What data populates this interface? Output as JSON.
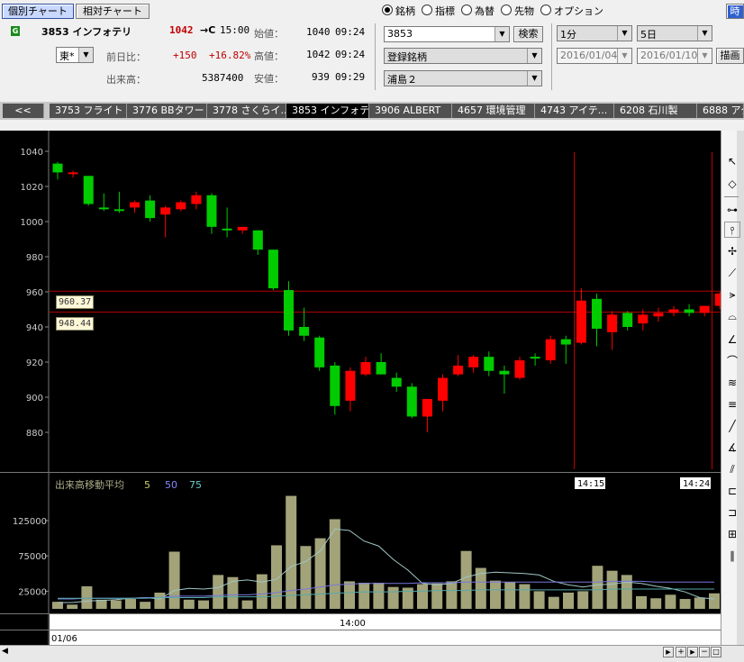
{
  "header": {
    "tab_individual": "個別チャート",
    "tab_relative": "相対チャート",
    "badge": "G",
    "code_name": "3853 インフォテリ",
    "price": "1042",
    "price_arrow": "→C",
    "price_time": "15:00",
    "open_label": "始値：",
    "open_value": "1040",
    "open_time": "09:24",
    "market": "東*",
    "change_label": "前日比：",
    "change_value": "+150",
    "change_pct": "+16.82%",
    "high_label": "高値：",
    "high_value": "1042",
    "high_time": "09:24",
    "volume_label": "出来高：",
    "volume_value": "5387400",
    "low_label": "安値：",
    "low_value": "939",
    "low_time": "09:29"
  },
  "controls": {
    "radios": [
      "銘柄",
      "指標",
      "為替",
      "先物",
      "オプション"
    ],
    "symbol_value": "3853",
    "search_button": "検索",
    "list1": "登録銘柄",
    "list2": "浦島２",
    "interval": "1分",
    "span": "5日",
    "date_from": "2016/01/04",
    "date_to": "2016/01/10",
    "draw_button": "描画",
    "corner": "時"
  },
  "tabs": [
    "<<",
    "3753 フライト",
    "3776 BBタワー",
    "3778 さくらイ...",
    "3853 インフォテリ",
    "3906 ALBERT",
    "4657 環境管理",
    "4743 アイテ...",
    "6208 石川製",
    "6888 アク"
  ],
  "price_axis": [
    "1040",
    "1020",
    "1000",
    "980",
    "960",
    "940",
    "920",
    "900",
    "880"
  ],
  "line_labels": {
    "upper": "960.37",
    "lower": "948.44"
  },
  "time_markers": {
    "left": "14:15",
    "right": "14:24"
  },
  "volume": {
    "title": "出来高移動平均",
    "ma": [
      "5",
      "50",
      "75"
    ],
    "axis": [
      "125000",
      "75000",
      "25000"
    ]
  },
  "x_axis": {
    "time": "14:00",
    "date": "01/06"
  },
  "colors": {
    "up": "#ff0000",
    "down": "#00cc00",
    "bg": "#000000",
    "volume_bar": "#a3a37a"
  },
  "chart_data": {
    "type": "candlestick",
    "ylim": [
      860,
      1045
    ],
    "candles": [
      {
        "o": 1033,
        "h": 1034,
        "l": 1024,
        "c": 1028
      },
      {
        "o": 1027,
        "h": 1029,
        "l": 1025,
        "c": 1028
      },
      {
        "o": 1026,
        "h": 1026,
        "l": 1009,
        "c": 1010
      },
      {
        "o": 1008,
        "h": 1016,
        "l": 1006,
        "c": 1007
      },
      {
        "o": 1007,
        "h": 1017,
        "l": 1005,
        "c": 1006
      },
      {
        "o": 1008,
        "h": 1012,
        "l": 1005,
        "c": 1011
      },
      {
        "o": 1012,
        "h": 1015,
        "l": 1000,
        "c": 1002
      },
      {
        "o": 1004,
        "h": 1009,
        "l": 991,
        "c": 1008
      },
      {
        "o": 1007,
        "h": 1012,
        "l": 1006,
        "c": 1011
      },
      {
        "o": 1010,
        "h": 1017,
        "l": 1007,
        "c": 1015
      },
      {
        "o": 1015,
        "h": 1016,
        "l": 993,
        "c": 997
      },
      {
        "o": 996,
        "h": 1008,
        "l": 991,
        "c": 995
      },
      {
        "o": 995,
        "h": 997,
        "l": 993,
        "c": 997
      },
      {
        "o": 995,
        "h": 995,
        "l": 981,
        "c": 984
      },
      {
        "o": 984,
        "h": 984,
        "l": 961,
        "c": 962
      },
      {
        "o": 961,
        "h": 966,
        "l": 935,
        "c": 938
      },
      {
        "o": 940,
        "h": 951,
        "l": 932,
        "c": 935
      },
      {
        "o": 934,
        "h": 935,
        "l": 915,
        "c": 917
      },
      {
        "o": 918,
        "h": 920,
        "l": 890,
        "c": 895
      },
      {
        "o": 898,
        "h": 917,
        "l": 892,
        "c": 915
      },
      {
        "o": 913,
        "h": 923,
        "l": 912,
        "c": 920
      },
      {
        "o": 920,
        "h": 925,
        "l": 913,
        "c": 913
      },
      {
        "o": 911,
        "h": 914,
        "l": 903,
        "c": 906
      },
      {
        "o": 906,
        "h": 908,
        "l": 888,
        "c": 889
      },
      {
        "o": 889,
        "h": 899,
        "l": 880,
        "c": 899
      },
      {
        "o": 898,
        "h": 913,
        "l": 892,
        "c": 911
      },
      {
        "o": 913,
        "h": 924,
        "l": 912,
        "c": 918
      },
      {
        "o": 917,
        "h": 924,
        "l": 914,
        "c": 923
      },
      {
        "o": 923,
        "h": 926,
        "l": 912,
        "c": 915
      },
      {
        "o": 915,
        "h": 918,
        "l": 902,
        "c": 913
      },
      {
        "o": 911,
        "h": 923,
        "l": 910,
        "c": 921
      },
      {
        "o": 923,
        "h": 925,
        "l": 918,
        "c": 922
      },
      {
        "o": 921,
        "h": 935,
        "l": 919,
        "c": 933
      },
      {
        "o": 933,
        "h": 935,
        "l": 919,
        "c": 930
      },
      {
        "o": 931,
        "h": 962,
        "l": 930,
        "c": 955
      },
      {
        "o": 956,
        "h": 959,
        "l": 929,
        "c": 939
      },
      {
        "o": 937,
        "h": 949,
        "l": 927,
        "c": 947
      },
      {
        "o": 948,
        "h": 949,
        "l": 938,
        "c": 940
      },
      {
        "o": 942,
        "h": 950,
        "l": 938,
        "c": 947
      },
      {
        "o": 946,
        "h": 951,
        "l": 943,
        "c": 948
      },
      {
        "o": 948,
        "h": 952,
        "l": 946,
        "c": 950
      },
      {
        "o": 950,
        "h": 953,
        "l": 946,
        "c": 948
      },
      {
        "o": 948,
        "h": 952,
        "l": 946,
        "c": 952
      },
      {
        "o": 952,
        "h": 960,
        "l": 950,
        "c": 959
      }
    ],
    "volumes": [
      10000,
      6000,
      32000,
      13000,
      12000,
      14000,
      10000,
      23000,
      81000,
      13000,
      12000,
      48000,
      45000,
      12000,
      49000,
      90000,
      160000,
      89000,
      100000,
      127000,
      39000,
      37000,
      37000,
      31000,
      30000,
      35000,
      36000,
      39000,
      82000,
      58000,
      40000,
      38000,
      35000,
      25000,
      17000,
      23000,
      25000,
      61000,
      54000,
      48000,
      18000,
      15000,
      20000,
      14000,
      16000,
      22000
    ],
    "ma_series": {
      "ma5": [
        9000,
        9000,
        11000,
        12000,
        13000,
        15000,
        16000,
        14000,
        26000,
        29000,
        28000,
        30000,
        39000,
        41000,
        38000,
        42000,
        60000,
        67000,
        82000,
        113000,
        111000,
        96000,
        89000,
        70000,
        55000,
        36000,
        34000,
        36000,
        45000,
        50000,
        52000,
        51000,
        50000,
        48000,
        39000,
        34000,
        31000,
        34000,
        35000,
        38000,
        36000,
        32000,
        29000,
        24000,
        16000,
        14000
      ],
      "ma50": [
        14000,
        14000,
        15000,
        15000,
        15000,
        15000,
        16000,
        16000,
        18000,
        18000,
        18000,
        19000,
        20000,
        20000,
        21000,
        23000,
        26000,
        28000,
        31000,
        34000,
        35000,
        36000,
        36000,
        36000,
        36000,
        37000,
        37000,
        37000,
        38000,
        38000,
        38000,
        38000,
        38000,
        38000,
        38000,
        38000,
        38000,
        38000,
        39000,
        39000,
        39000,
        38000,
        38000,
        38000,
        38000,
        38000
      ],
      "ma75": [
        15000,
        15000,
        15000,
        15000,
        15000,
        15000,
        15000,
        16000,
        16000,
        16000,
        16000,
        17000,
        17000,
        17000,
        17000,
        18000,
        19000,
        20000,
        21000,
        22000,
        23000,
        24000,
        24000,
        24000,
        25000,
        25000,
        26000,
        26000,
        26000,
        27000,
        27000,
        27000,
        27000,
        27000,
        27000,
        27000,
        27000,
        27000,
        28000,
        28000,
        28000,
        28000,
        28000,
        28000,
        28000,
        28000
      ]
    },
    "hlines": [
      960.37,
      948.44
    ],
    "volume_ylim": [
      0,
      175000
    ]
  }
}
